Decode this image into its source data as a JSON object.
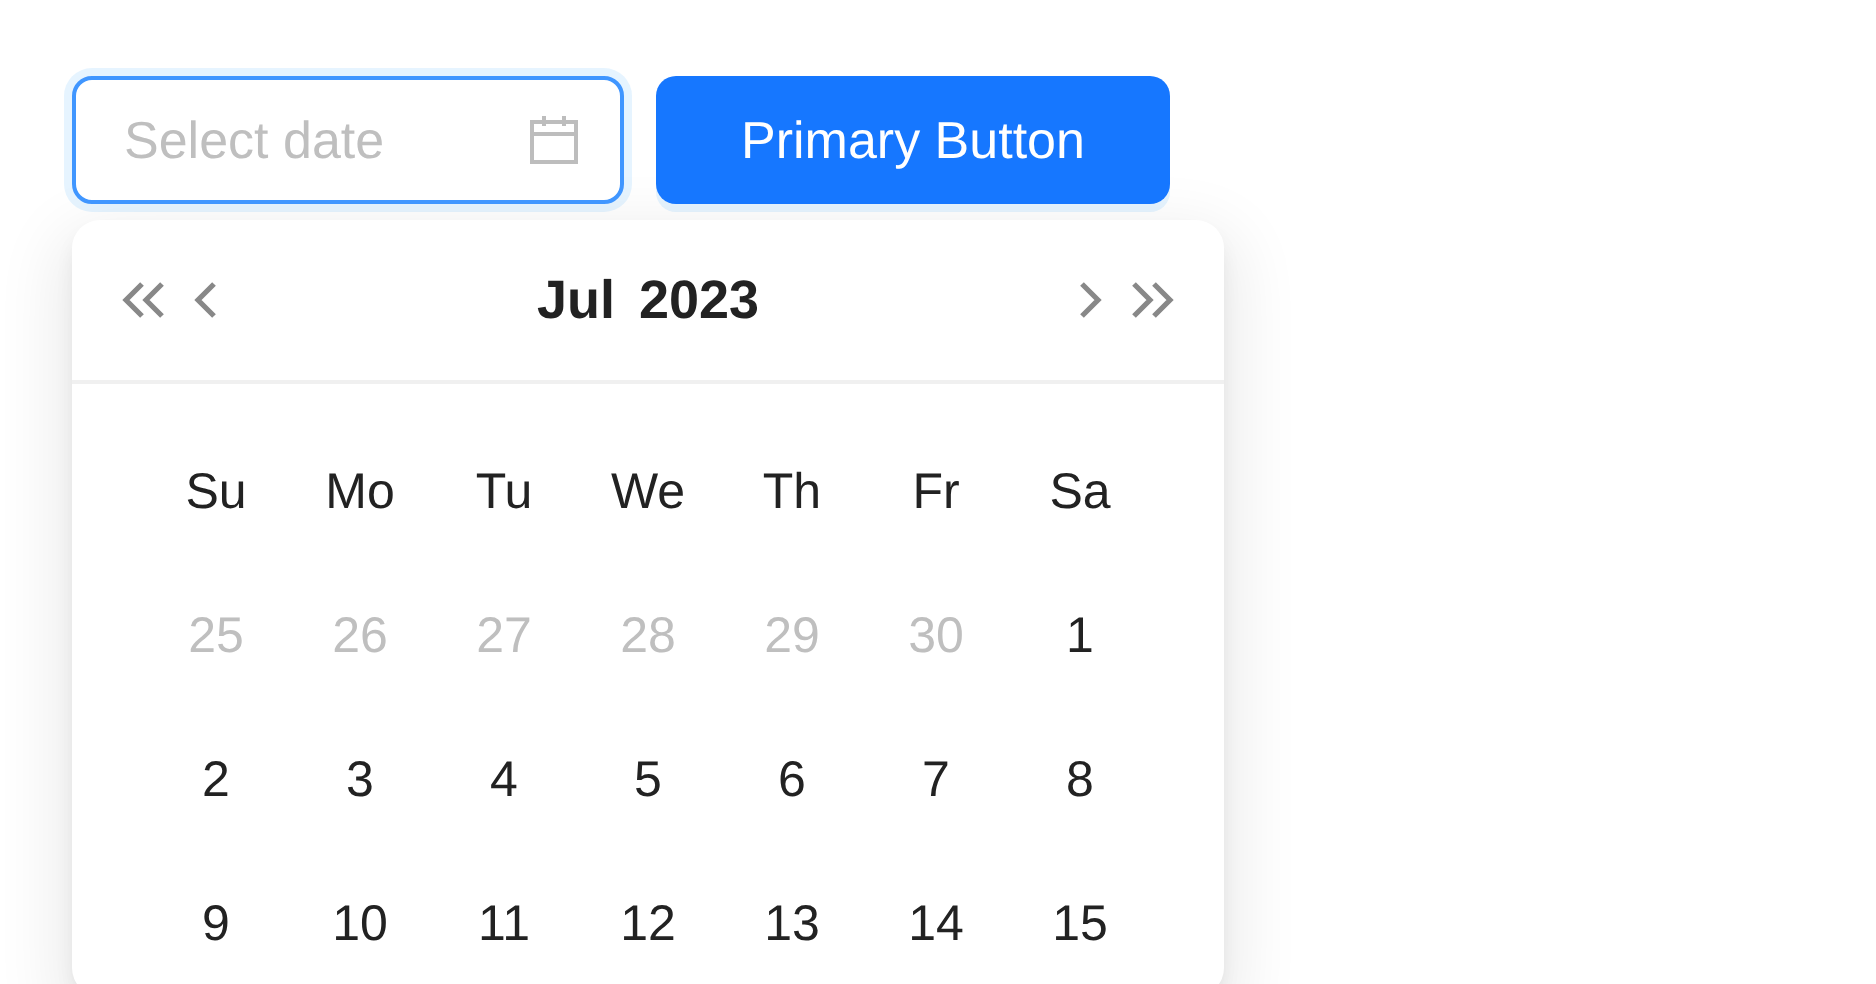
{
  "date_field": {
    "placeholder": "Select date",
    "focused": true
  },
  "primary_button": {
    "label": "Primary Button"
  },
  "calendar": {
    "month": "Jul",
    "year": "2023",
    "weekdays": [
      "Su",
      "Mo",
      "Tu",
      "We",
      "Th",
      "Fr",
      "Sa"
    ],
    "weeks": [
      [
        {
          "day": "25",
          "in_month": false
        },
        {
          "day": "26",
          "in_month": false
        },
        {
          "day": "27",
          "in_month": false
        },
        {
          "day": "28",
          "in_month": false
        },
        {
          "day": "29",
          "in_month": false
        },
        {
          "day": "30",
          "in_month": false
        },
        {
          "day": "1",
          "in_month": true
        }
      ],
      [
        {
          "day": "2",
          "in_month": true
        },
        {
          "day": "3",
          "in_month": true
        },
        {
          "day": "4",
          "in_month": true
        },
        {
          "day": "5",
          "in_month": true
        },
        {
          "day": "6",
          "in_month": true
        },
        {
          "day": "7",
          "in_month": true
        },
        {
          "day": "8",
          "in_month": true
        }
      ],
      [
        {
          "day": "9",
          "in_month": true
        },
        {
          "day": "10",
          "in_month": true
        },
        {
          "day": "11",
          "in_month": true
        },
        {
          "day": "12",
          "in_month": true
        },
        {
          "day": "13",
          "in_month": true
        },
        {
          "day": "14",
          "in_month": true
        },
        {
          "day": "15",
          "in_month": true
        }
      ]
    ]
  }
}
